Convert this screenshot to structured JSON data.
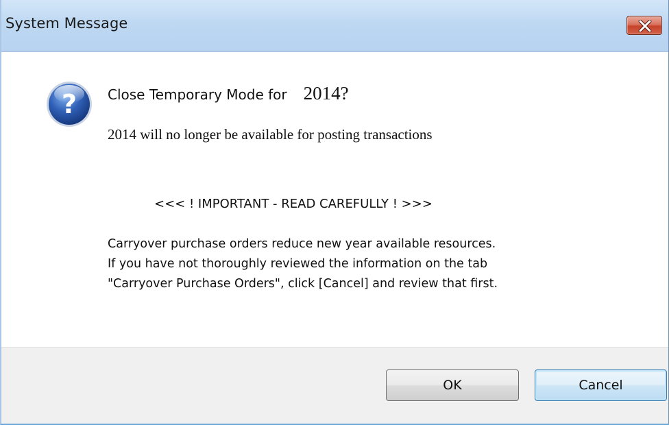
{
  "window": {
    "title": "System Message"
  },
  "titlebar": {
    "close_icon": "close-icon",
    "close_color": "#c7432a"
  },
  "message": {
    "icon": "question-icon",
    "heading_prefix": "Close Temporary Mode for",
    "heading_year": "2014?",
    "subline": "2014 will no longer be available for posting transactions",
    "important": "<<< ! IMPORTANT - READ CAREFULLY ! >>>",
    "body_lines": [
      "Carryover purchase orders reduce new year available resources.",
      "If you have not thoroughly reviewed the information on the tab",
      "\"Carryover Purchase Orders\", click [Cancel] and review that first."
    ]
  },
  "buttons": {
    "ok_label": "OK",
    "cancel_label": "Cancel"
  },
  "colors": {
    "titlebar": "#bed8f2",
    "icon_blue": "#2f5fb5",
    "default_button_border": "#3c7fb1",
    "footer": "#f0f0f0"
  }
}
